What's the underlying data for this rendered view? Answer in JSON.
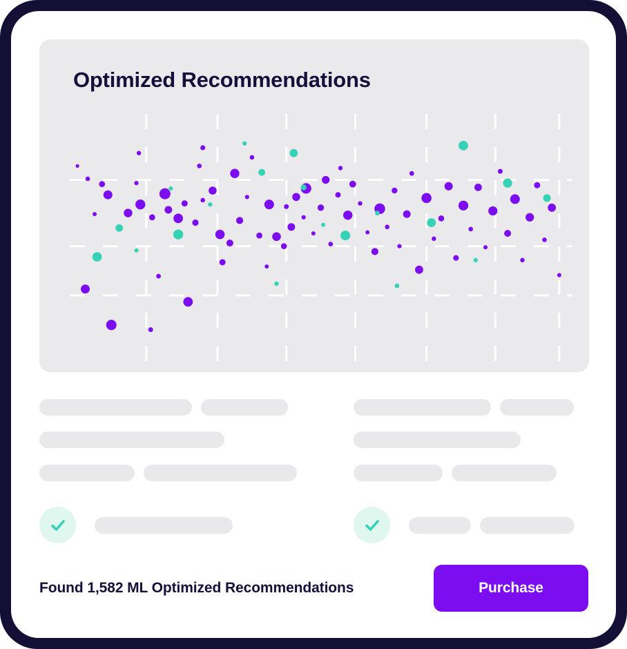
{
  "frame": {
    "background_color": "#130F35",
    "card_color": "#ffffff"
  },
  "chart_panel": {
    "title": "Optimized Recommendations",
    "background_color": "#eaeaec"
  },
  "chart_data": {
    "type": "scatter",
    "title": "Optimized Recommendations",
    "xlabel": "",
    "ylabel": "",
    "xlim": [
      0,
      100
    ],
    "ylim": [
      0,
      100
    ],
    "grid": true,
    "grid_style": "dashed",
    "grid_color": "#ffffff",
    "grid_x": [
      15,
      29.5,
      43.5,
      57.5,
      72,
      86,
      99
    ],
    "grid_y": [
      21,
      44,
      75
    ],
    "legend": [],
    "series": [
      {
        "name": "primary",
        "color": "#7B0DF0",
        "points": [
          [
            7.9,
            7.2,
            7.5
          ],
          [
            2.6,
            24.0,
            6.5
          ],
          [
            15.9,
            5.0,
            3.5
          ],
          [
            23.5,
            18.0,
            6.9
          ],
          [
            17.5,
            30.0,
            3.4
          ],
          [
            4.5,
            59.0,
            3.0
          ],
          [
            7.2,
            68.0,
            6.5
          ],
          [
            3.1,
            75.5,
            3.3
          ],
          [
            6.0,
            73.0,
            4.4
          ],
          [
            1.0,
            81.5,
            2.6
          ],
          [
            13.0,
            73.5,
            3.1
          ],
          [
            11.3,
            59.5,
            6.2
          ],
          [
            13.8,
            63.5,
            7.2
          ],
          [
            16.2,
            57.5,
            4.4
          ],
          [
            19.5,
            61.0,
            5.5
          ],
          [
            21.5,
            57.0,
            6.9
          ],
          [
            18.8,
            68.5,
            8.0
          ],
          [
            22.8,
            64.0,
            4.5
          ],
          [
            25.0,
            55.0,
            4.6
          ],
          [
            26.5,
            65.5,
            3.3
          ],
          [
            28.5,
            70.0,
            5.8
          ],
          [
            13.5,
            87.5,
            3.2
          ],
          [
            25.8,
            81.5,
            3.4
          ],
          [
            30.0,
            49.5,
            6.8
          ],
          [
            30.5,
            36.5,
            4.5
          ],
          [
            32.0,
            45.5,
            5.0
          ],
          [
            34.0,
            56.0,
            5.1
          ],
          [
            33.0,
            78.0,
            6.7
          ],
          [
            26.5,
            90.0,
            3.6
          ],
          [
            35.5,
            67.0,
            3.1
          ],
          [
            36.5,
            85.5,
            3.3
          ],
          [
            39.5,
            34.5,
            3.0
          ],
          [
            38.0,
            49.0,
            4.4
          ],
          [
            41.5,
            48.5,
            6.3
          ],
          [
            43.0,
            44.0,
            4.3
          ],
          [
            44.5,
            53.0,
            5.5
          ],
          [
            40.0,
            63.5,
            7.0
          ],
          [
            43.5,
            62.5,
            3.5
          ],
          [
            45.5,
            67.0,
            5.8
          ],
          [
            47.0,
            57.5,
            3.1
          ],
          [
            47.5,
            71.0,
            7.6
          ],
          [
            49.0,
            50.0,
            3.0
          ],
          [
            50.5,
            62.0,
            4.7
          ],
          [
            51.5,
            75.0,
            5.6
          ],
          [
            52.5,
            45.0,
            3.4
          ],
          [
            54.0,
            68.0,
            4.0
          ],
          [
            54.5,
            80.5,
            3.2
          ],
          [
            56.0,
            58.5,
            6.7
          ],
          [
            57.0,
            73.0,
            4.9
          ],
          [
            58.5,
            64.0,
            3.2
          ],
          [
            60.0,
            50.5,
            3.0
          ],
          [
            61.5,
            41.5,
            5.1
          ],
          [
            62.5,
            61.5,
            7.7
          ],
          [
            64.0,
            53.0,
            3.3
          ],
          [
            65.5,
            70.0,
            4.2
          ],
          [
            66.5,
            44.0,
            3.1
          ],
          [
            68.0,
            59.0,
            5.5
          ],
          [
            69.0,
            78.0,
            3.4
          ],
          [
            70.5,
            33.0,
            5.9
          ],
          [
            72.0,
            66.5,
            7.3
          ],
          [
            73.5,
            47.5,
            3.2
          ],
          [
            75.0,
            57.0,
            4.3
          ],
          [
            76.5,
            72.0,
            6.0
          ],
          [
            78.0,
            38.5,
            4.1
          ],
          [
            79.5,
            63.0,
            7.1
          ],
          [
            81.0,
            52.0,
            3.3
          ],
          [
            82.5,
            71.5,
            5.4
          ],
          [
            84.0,
            43.5,
            3.0
          ],
          [
            85.5,
            60.5,
            6.6
          ],
          [
            87.0,
            79.0,
            3.5
          ],
          [
            88.5,
            50.0,
            5.0
          ],
          [
            90.0,
            66.0,
            7.0
          ],
          [
            91.5,
            37.5,
            3.2
          ],
          [
            93.0,
            57.5,
            6.1
          ],
          [
            94.5,
            72.5,
            4.5
          ],
          [
            96.0,
            47.0,
            3.3
          ],
          [
            97.5,
            62.0,
            5.9
          ],
          [
            99.0,
            30.5,
            3.0
          ]
        ]
      },
      {
        "name": "highlight",
        "color": "#35D2B5",
        "points": [
          [
            5.0,
            39.0,
            6.8
          ],
          [
            9.5,
            52.5,
            5.4
          ],
          [
            13.0,
            42.0,
            3.0
          ],
          [
            21.5,
            49.5,
            7.2
          ],
          [
            28.0,
            63.5,
            3.2
          ],
          [
            35.0,
            92.0,
            3.1
          ],
          [
            38.5,
            78.5,
            5.0
          ],
          [
            45.0,
            87.5,
            5.9
          ],
          [
            47.0,
            71.5,
            4.2
          ],
          [
            51.0,
            54.0,
            3.0
          ],
          [
            55.5,
            49.0,
            7.0
          ],
          [
            62.0,
            59.5,
            3.4
          ],
          [
            66.0,
            25.5,
            3.3
          ],
          [
            73.0,
            55.0,
            6.4
          ],
          [
            79.5,
            91.0,
            6.9
          ],
          [
            88.5,
            73.5,
            6.6
          ],
          [
            96.5,
            66.5,
            5.5
          ],
          [
            41.5,
            26.5,
            3.2
          ],
          [
            82.0,
            37.5,
            3.1
          ],
          [
            20.0,
            71.0,
            3.0
          ]
        ]
      }
    ]
  },
  "skeleton": {
    "left_column": [
      [
        221,
        0,
        126
      ],
      [
        268,
        0,
        0
      ],
      [
        138,
        0,
        222
      ]
    ],
    "right_column": [
      [
        199,
        0,
        107
      ],
      [
        242,
        0,
        0
      ],
      [
        129,
        0,
        152
      ]
    ]
  },
  "checks": {
    "icon": "check-icon",
    "icon_color": "#35D2B5",
    "icon_background": "#dff7ef",
    "left_bars": [
      200
    ],
    "right_bars": [
      90,
      137
    ]
  },
  "footer": {
    "result_text": "Found 1,582 ML Optimized Recommendations",
    "purchase_label": "Purchase",
    "purchase_color": "#7B0DF0"
  }
}
